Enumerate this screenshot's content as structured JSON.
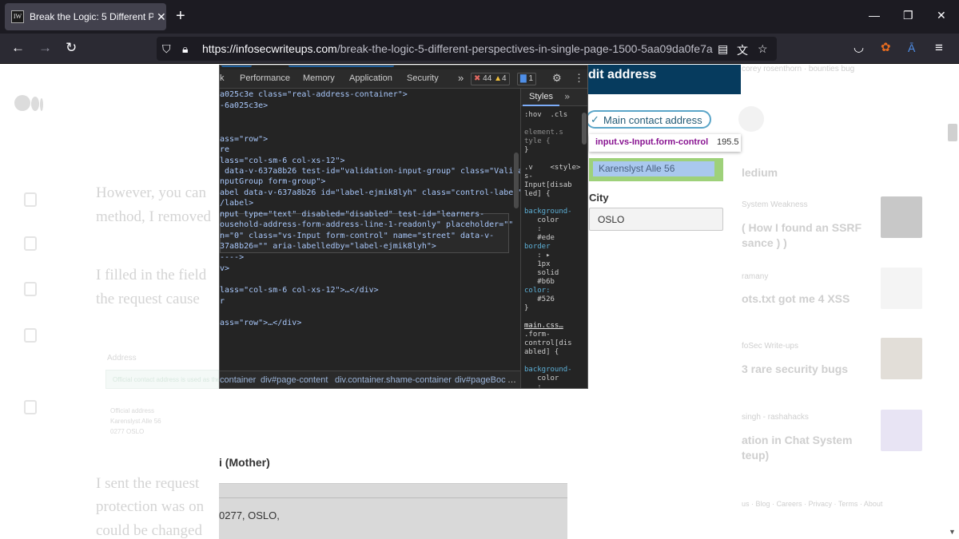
{
  "browser": {
    "tab_title": "Break the Logic: 5 Different Pers",
    "favicon_text": "IW",
    "url_host": "https://infosecwriteups.com",
    "url_path": "/break-the-logic-5-different-perspectives-in-single-page-1500-5aa09da0fe7a"
  },
  "article": {
    "lines": [
      "However, you can",
      "method, I removed",
      "I filled in the field",
      "the request cause",
      "I sent the request",
      "protection was on",
      "could be changed"
    ],
    "faded_box_label": "Address",
    "faded_box_text": "Official contact address is used as the main",
    "faded_small": [
      "Official address",
      "Karenslyst Alle 56",
      "0277 OSLO"
    ]
  },
  "embedded": {
    "mother_label": "i (Mother)",
    "mother_address": "0277, OSLO,"
  },
  "form": {
    "header": "dit address",
    "pill_label": "Main contact address",
    "tooltip_selector": "input.vs-Input.form-control",
    "tooltip_size": "195.5",
    "street_value": "Karenslyst Alle 56",
    "city_label": "City",
    "city_value": "OSLO"
  },
  "devtools": {
    "tabs": [
      "k",
      "Performance",
      "Memory",
      "Application",
      "Security"
    ],
    "more": "»",
    "errors": "44",
    "warnings": "4",
    "messages": "1",
    "code_lines": [
      {
        "pre": "",
        "tag": "",
        "content": "a025c3e class=\"real-address-container\">"
      },
      {
        "pre": "",
        "tag": "",
        "content": "-6a025c3e>"
      },
      {
        "pre": "",
        "tag": "",
        "content": ""
      },
      {
        "pre": "",
        "tag": "",
        "content": ""
      },
      {
        "pre": "",
        "tag": "",
        "content": "ass=\"row\">"
      },
      {
        "pre": "",
        "tag": "",
        "content": "re"
      },
      {
        "pre": "",
        "tag": "",
        "content": "lass=\"col-sm-6 col-xs-12\">"
      },
      {
        "pre": "",
        "tag": "",
        "content": " data-v-637a8b26 test-id=\"validation-input-group\" class=\"Validat"
      },
      {
        "pre": "",
        "tag": "",
        "content": "nputGroup form-group\">"
      },
      {
        "pre": "",
        "tag": "",
        "content": "abel data-v-637a8b26 id=\"label-ejmik8lyh\" class=\"control-label\">"
      },
      {
        "pre": "",
        "tag": "",
        "content": "/label>"
      },
      {
        "pre": "",
        "tag": "",
        "content": "nput type=\"text\" disabled=\"disabled\" test-id=\"learners-"
      },
      {
        "pre": "",
        "tag": "",
        "content": "ousehold-address-form-address-line-1-readonly\" placeholder=\"\""
      },
      {
        "pre": "",
        "tag": "",
        "content": "n=\"0\" class=\"vs-Input form-control\" name=\"street\" data-v-"
      },
      {
        "pre": "",
        "tag": "",
        "content": "37a8b26=\"\" aria-labelledby=\"label-ejmik8lyh\">"
      },
      {
        "pre": "",
        "tag": "",
        "content": "---->"
      },
      {
        "pre": "",
        "tag": "",
        "content": "v>"
      },
      {
        "pre": "",
        "tag": "",
        "content": ""
      },
      {
        "pre": "",
        "tag": "",
        "content": "lass=\"col-sm-6 col-xs-12\">…</div>"
      },
      {
        "pre": "",
        "tag": "",
        "content": "r"
      },
      {
        "pre": "",
        "tag": "",
        "content": ""
      },
      {
        "pre": "",
        "tag": "",
        "content": "ass=\"row\">…</div>"
      }
    ],
    "breadcrumbs": [
      "container",
      "div#page-content",
      "div.container.shame-container",
      "div#pageBoc",
      "…"
    ],
    "styles_tab": "Styles",
    "styles_more": "»",
    "styles_lines": [
      ":hov  .cls",
      "",
      "element.s",
      "tyle {",
      "}",
      "",
      ".v    <style>",
      "s-",
      "Input[disab",
      "led] {",
      "",
      "background-",
      "   color",
      "   :",
      "   #ede",
      "border",
      "   : ▸",
      "   1px",
      "   solid",
      "   #b6b",
      "color:",
      "   #526",
      "}",
      "",
      "main.css…",
      ".form-",
      "control[dis",
      "abled] {",
      "",
      "background-",
      "   color",
      "   :"
    ]
  },
  "sidebar": {
    "top_text": "corey rosenthorn · bounties bug",
    "medium_label": "ledium",
    "items": [
      {
        "author": "System Weakness",
        "title1": "( How I found an SSRF",
        "title2": "sance ) )"
      },
      {
        "author": "ramany",
        "title1": "ots.txt got me 4 XSS",
        "title2": ""
      },
      {
        "author": "foSec Write-ups",
        "title1": "3 rare security bugs",
        "title2": ""
      },
      {
        "author": "singh - rashahacks",
        "title1": "ation in Chat System",
        "title2": "teup)"
      }
    ],
    "footer": "us · Blog · Careers · Privacy · Terms · About"
  },
  "colors": {
    "tabbar": "#1c1b22",
    "navbar": "#2b2a33",
    "devtools_bg": "#242424",
    "form_header": "#063b5e"
  }
}
